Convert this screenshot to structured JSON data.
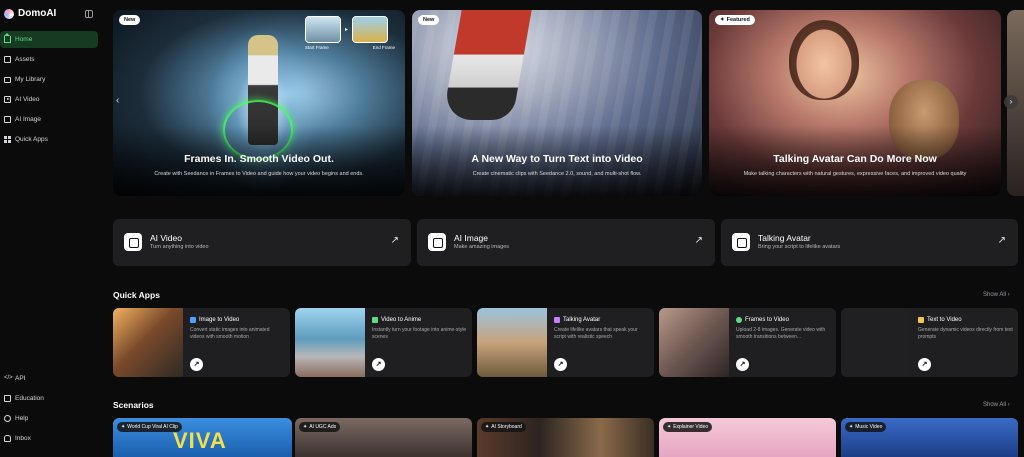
{
  "brand": {
    "name": "DomoAI"
  },
  "sidebar": {
    "items": [
      {
        "label": "Home",
        "icon": "home-icon",
        "active": true
      },
      {
        "label": "Assets",
        "icon": "assets-icon"
      },
      {
        "label": "My Library",
        "icon": "folder-icon"
      },
      {
        "label": "AI Video",
        "icon": "video-icon"
      },
      {
        "label": "AI Image",
        "icon": "image-icon"
      },
      {
        "label": "Quick Apps",
        "icon": "grid-icon"
      }
    ],
    "bottom_items": [
      {
        "label": "API",
        "icon": "code-icon"
      },
      {
        "label": "Education",
        "icon": "education-icon"
      },
      {
        "label": "Help",
        "icon": "help-icon"
      },
      {
        "label": "Inbox",
        "icon": "bell-icon"
      }
    ],
    "accent": "#5fdc84"
  },
  "hero": {
    "slides": [
      {
        "badge": "New",
        "title": "Frames In. Smooth Video Out.",
        "subtitle": "Create with Seedance in Frames to Video and guide how your video begins and ends.",
        "start_label": "Start Frame",
        "end_label": "End Frame"
      },
      {
        "badge": "New",
        "title": "A New Way to Turn Text into Video",
        "subtitle": "Create cinematic clips with Seedance 2.0, sound, and multi-shot flow."
      },
      {
        "badge": "Featured",
        "title": "Talking Avatar Can Do More Now",
        "subtitle": "Make talking characters with natural gestures, expressive faces, and improved video quality"
      }
    ]
  },
  "features": [
    {
      "title": "AI Video",
      "subtitle": "Turn anything into video"
    },
    {
      "title": "AI Image",
      "subtitle": "Make amazing images"
    },
    {
      "title": "Talking Avatar",
      "subtitle": "Bring your script to lifelike avatars"
    }
  ],
  "quick_apps": {
    "title": "Quick Apps",
    "show_all": "Show All",
    "items": [
      {
        "title": "Image to Video",
        "desc": "Convert static images into animated videos with smooth motion",
        "icon_color": "#4aa3ff"
      },
      {
        "title": "Video to Anime",
        "desc": "Instantly turn your footage into anime-style scenes",
        "icon_color": "#5fdc84"
      },
      {
        "title": "Talking Avatar",
        "desc": "Create lifelike avatars that speak your script with realistic speech",
        "icon_color": "#c77dff"
      },
      {
        "title": "Frames to Video",
        "desc": "Upload 2-8 images. Generate video with smooth transitions between...",
        "icon_color": "#5fdc84"
      },
      {
        "title": "Text to Video",
        "desc": "Generate dynamic videos directly from text prompts",
        "icon_color": "#f3c74a"
      }
    ]
  },
  "scenarios": {
    "title": "Scenarios",
    "show_all": "Show All",
    "items": [
      {
        "badge": "World Cup Viral AI Clip",
        "big_text": "VIVA"
      },
      {
        "badge": "AI UGC Ads"
      },
      {
        "badge": "AI Storyboard"
      },
      {
        "badge": "Explainer Video"
      },
      {
        "badge": "Music Video"
      }
    ]
  }
}
